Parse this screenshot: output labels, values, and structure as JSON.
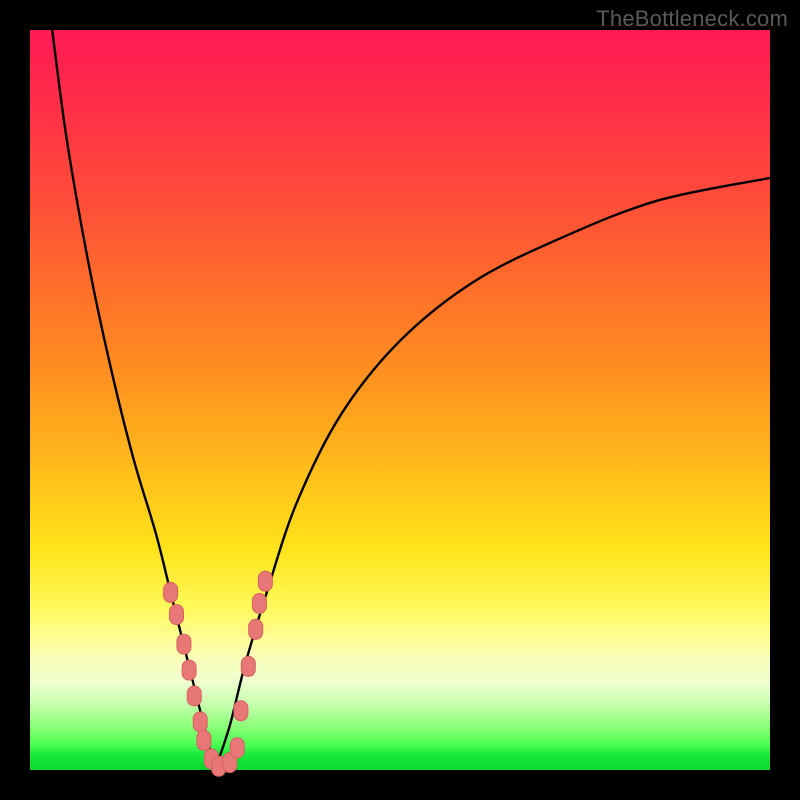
{
  "watermark": "TheBottleneck.com",
  "colors": {
    "frame_bg": "#000000",
    "gradient_top": "#ff1a55",
    "gradient_mid": "#ffd21a",
    "gradient_bottom": "#0bd82e",
    "curve": "#000000",
    "marker_fill": "#e87878",
    "marker_stroke": "#d86060"
  },
  "chart_data": {
    "type": "line",
    "title": "",
    "xlabel": "",
    "ylabel": "",
    "xlim": [
      0,
      100
    ],
    "ylim": [
      0,
      100
    ],
    "series": [
      {
        "name": "left-branch",
        "x": [
          3,
          5,
          8,
          11,
          14,
          17,
          19,
          21,
          22.5,
          24,
          25
        ],
        "y": [
          100,
          85,
          68,
          54,
          42,
          32,
          24,
          16,
          10,
          4,
          0
        ]
      },
      {
        "name": "right-branch",
        "x": [
          25,
          27,
          29,
          32,
          36,
          42,
          50,
          60,
          72,
          85,
          100
        ],
        "y": [
          0,
          6,
          14,
          24,
          36,
          48,
          58,
          66,
          72,
          77,
          80
        ]
      }
    ],
    "markers": [
      {
        "x": 19.0,
        "y": 24.0
      },
      {
        "x": 19.8,
        "y": 21.0
      },
      {
        "x": 20.8,
        "y": 17.0
      },
      {
        "x": 21.5,
        "y": 13.5
      },
      {
        "x": 22.2,
        "y": 10.0
      },
      {
        "x": 23.0,
        "y": 6.5
      },
      {
        "x": 23.5,
        "y": 4.0
      },
      {
        "x": 24.5,
        "y": 1.5
      },
      {
        "x": 25.5,
        "y": 0.5
      },
      {
        "x": 27.0,
        "y": 1.0
      },
      {
        "x": 28.0,
        "y": 3.0
      },
      {
        "x": 28.5,
        "y": 8.0
      },
      {
        "x": 29.5,
        "y": 14.0
      },
      {
        "x": 30.5,
        "y": 19.0
      },
      {
        "x": 31.0,
        "y": 22.5
      },
      {
        "x": 31.8,
        "y": 25.5
      }
    ]
  }
}
